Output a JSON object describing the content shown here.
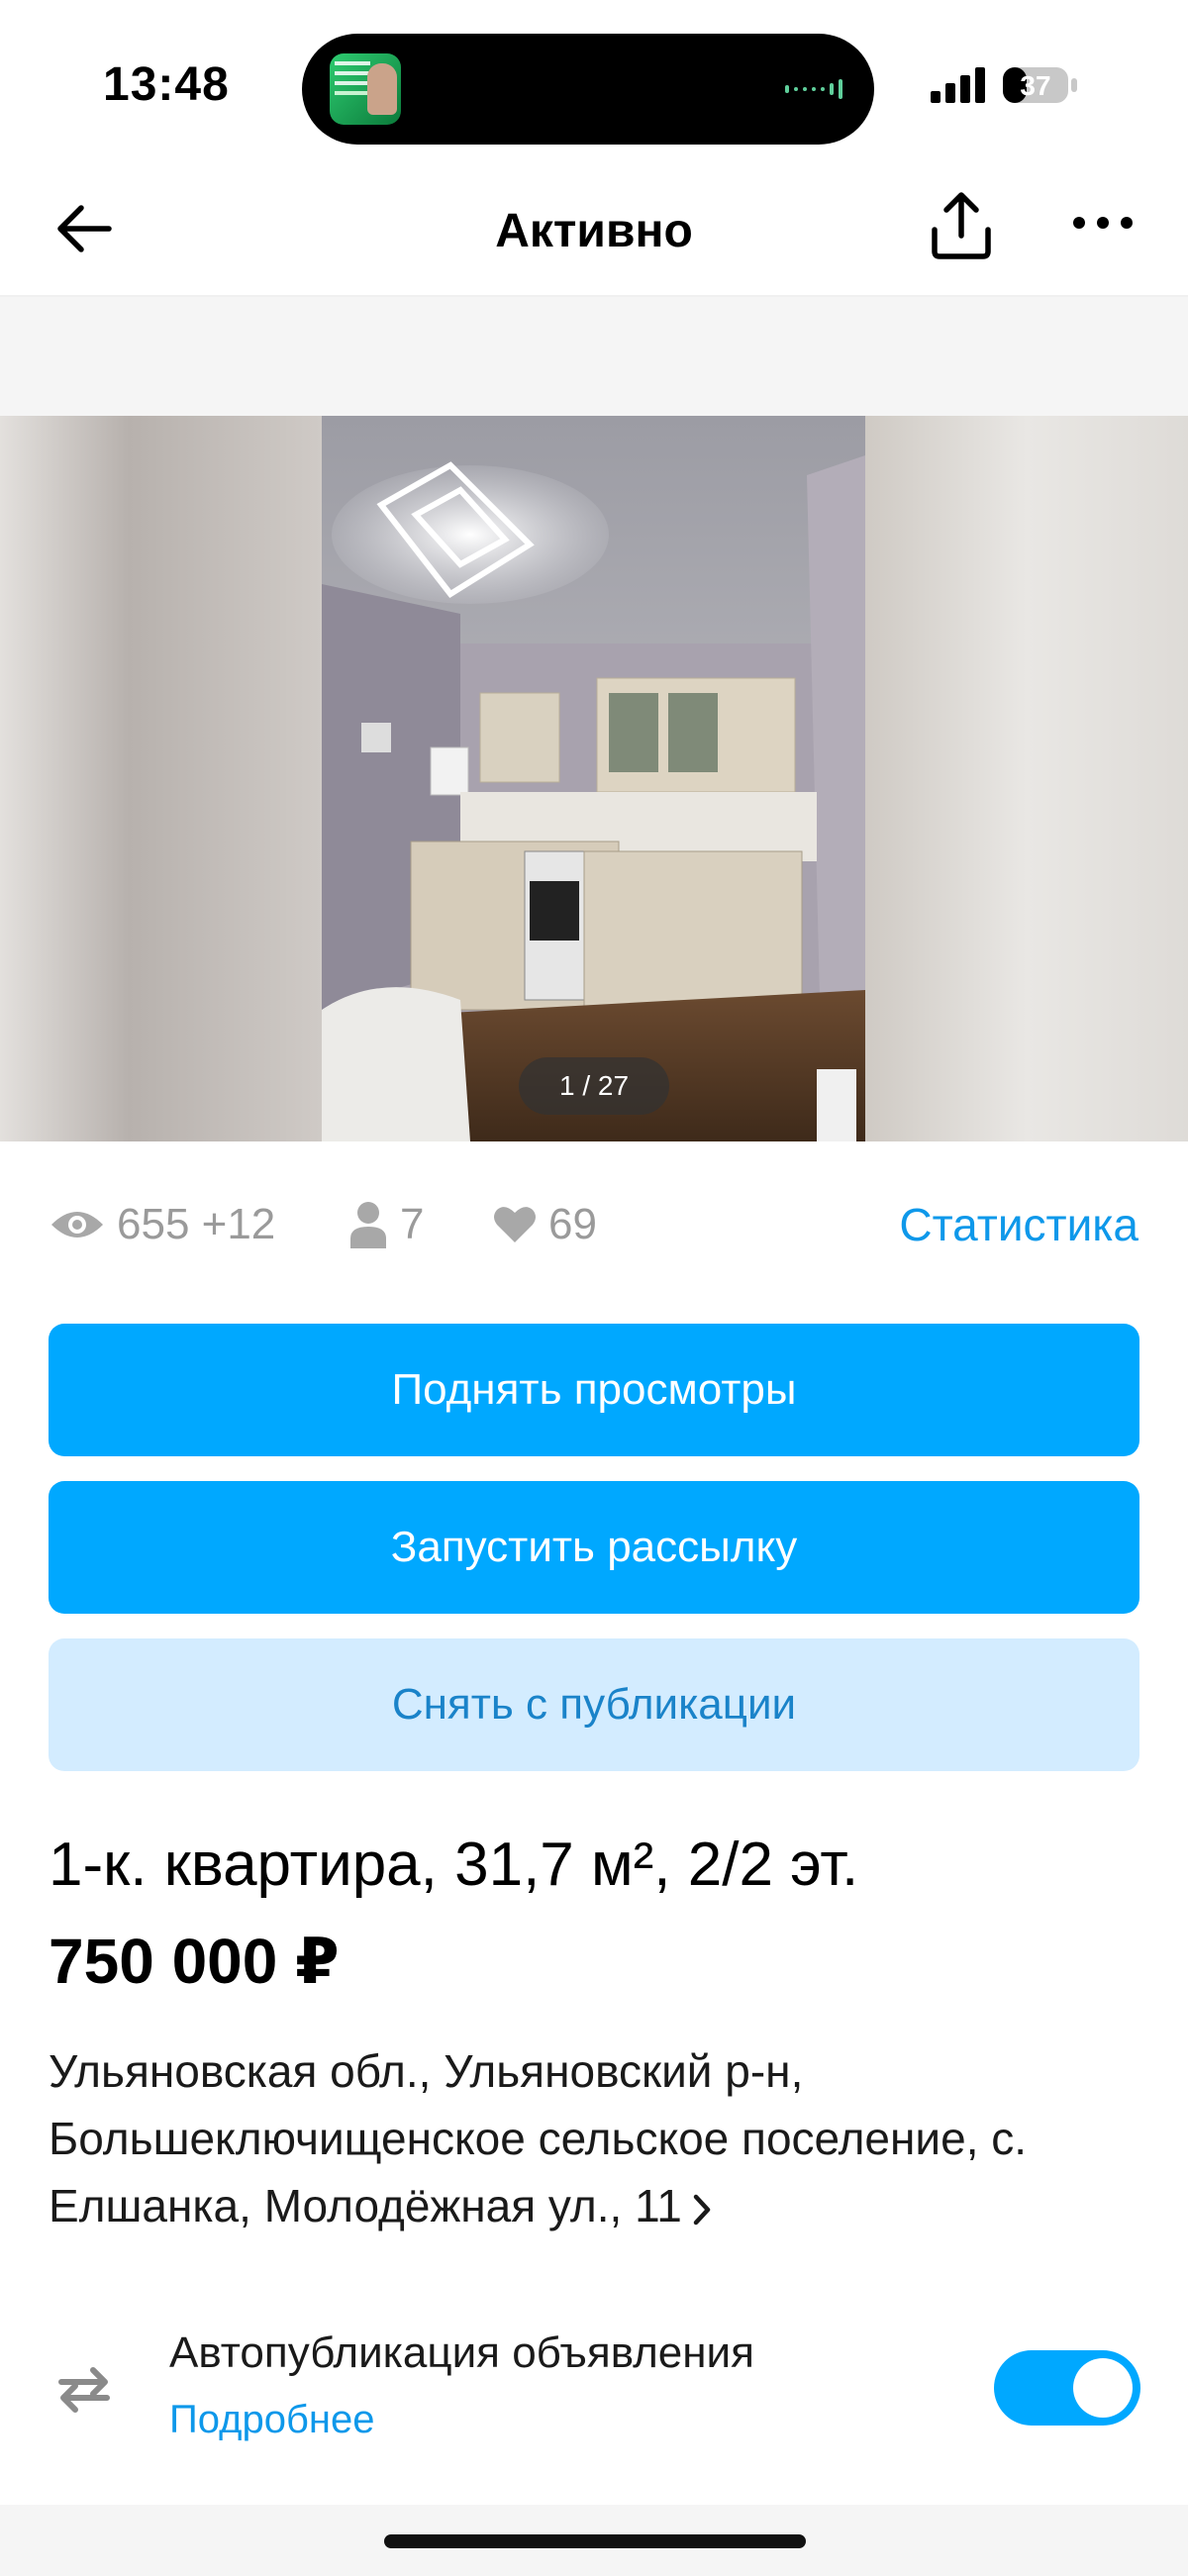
{
  "status": {
    "time": "13:48",
    "battery": "37"
  },
  "nav": {
    "title": "Активно"
  },
  "gallery": {
    "counter": "1 / 27"
  },
  "stats": {
    "views": "655 +12",
    "contacts": "7",
    "favorites": "69",
    "link_label": "Статистика"
  },
  "actions": {
    "raise_views": "Поднять просмотры",
    "start_mailing": "Запустить рассылку",
    "unpublish": "Снять с публикации"
  },
  "listing": {
    "title": "1-к. квартира, 31,7 м², 2/2 эт.",
    "price": "750 000 ₽",
    "address": "Ульяновская обл., Ульяновский р-н, Большеключищенское сельское поселение, с. Елшанка, Молодёжная ул., 11"
  },
  "autopublish": {
    "label": "Автопубликация объявления",
    "more": "Подробнее",
    "enabled": true
  },
  "colors": {
    "accent": "#00a8ff",
    "link": "#0e98ea",
    "soft_button": "#d3ecff",
    "muted_text": "#9a9a9a"
  },
  "icons": [
    "back-arrow-icon",
    "share-icon",
    "more-dots-icon",
    "eye-icon",
    "person-icon",
    "heart-icon",
    "chevron-right-icon",
    "repeat-icon"
  ]
}
